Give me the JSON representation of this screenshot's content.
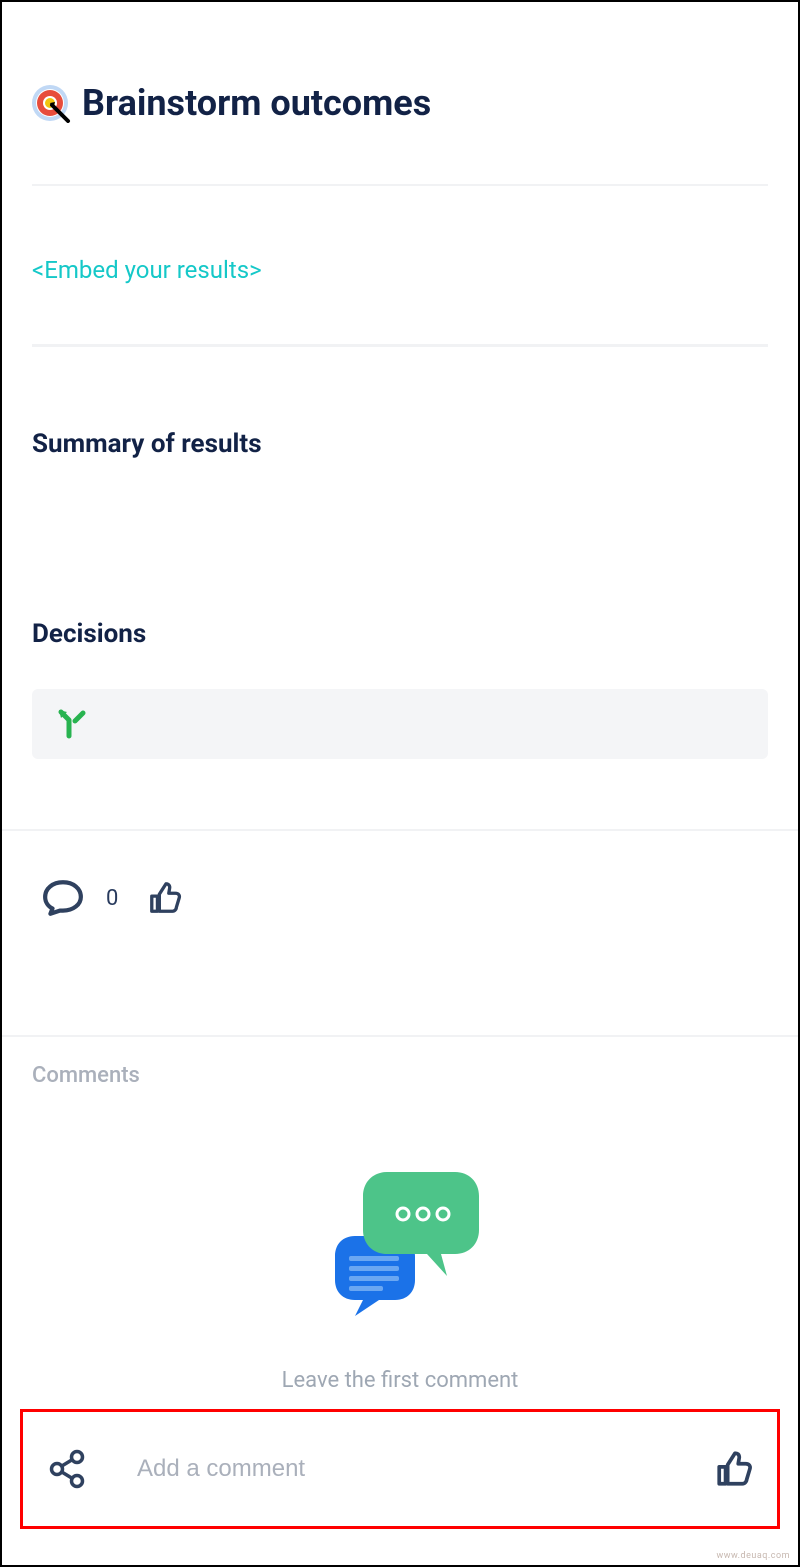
{
  "header": {
    "title": "Brainstorm outcomes",
    "icon": "dart-target-icon"
  },
  "embed": {
    "label": "<Embed your results>"
  },
  "sections": {
    "summary_heading": "Summary of results",
    "decisions_heading": "Decisions"
  },
  "reactions": {
    "comment_count": "0"
  },
  "comments": {
    "label": "Comments",
    "empty_prompt": "Leave the first comment"
  },
  "footer": {
    "input_placeholder": "Add a comment"
  },
  "watermark": "www.deuaq.com"
}
